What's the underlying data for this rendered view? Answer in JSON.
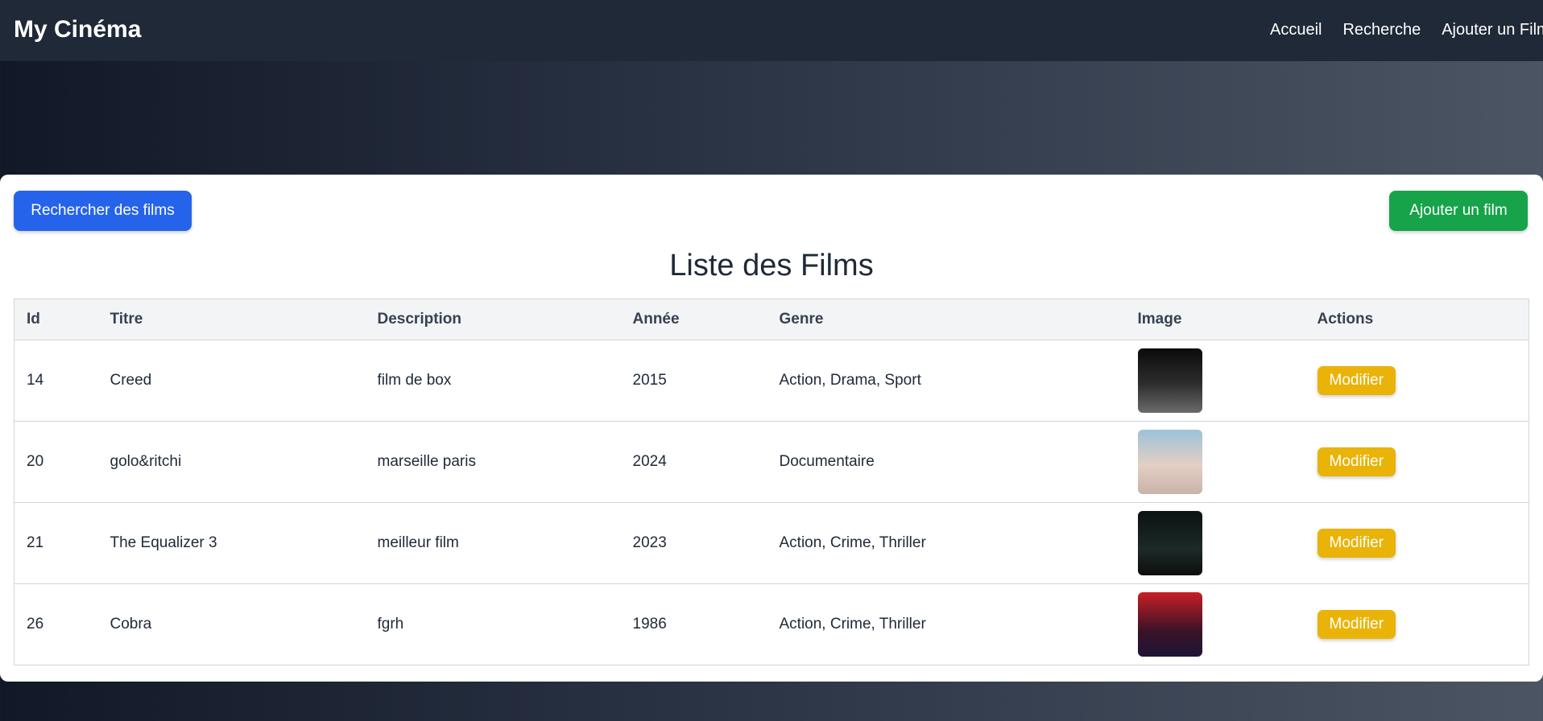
{
  "navbar": {
    "brand": "My Cinéma",
    "links": [
      "Accueil",
      "Recherche",
      "Ajouter un Film"
    ]
  },
  "actions": {
    "search_label": "Rechercher des films",
    "add_label": "Ajouter un film"
  },
  "title": "Liste des Films",
  "table": {
    "headers": [
      "Id",
      "Titre",
      "Description",
      "Année",
      "Genre",
      "Image",
      "Actions"
    ],
    "rows": [
      {
        "id": "14",
        "titre": "Creed",
        "description": "film de box",
        "annee": "2015",
        "genre": "Action, Drama, Sport",
        "action_label": "Modifier"
      },
      {
        "id": "20",
        "titre": "golo&ritchi",
        "description": "marseille paris",
        "annee": "2024",
        "genre": "Documentaire",
        "action_label": "Modifier"
      },
      {
        "id": "21",
        "titre": "The Equalizer 3",
        "description": "meilleur film",
        "annee": "2023",
        "genre": "Action, Crime, Thriller",
        "action_label": "Modifier"
      },
      {
        "id": "26",
        "titre": "Cobra",
        "description": "fgrh",
        "annee": "1986",
        "genre": "Action, Crime, Thriller",
        "action_label": "Modifier"
      }
    ]
  },
  "colors": {
    "navbar": "#1f2937",
    "search_button": "#2563eb",
    "add_button": "#16a34a",
    "modify_button": "#eab308"
  }
}
